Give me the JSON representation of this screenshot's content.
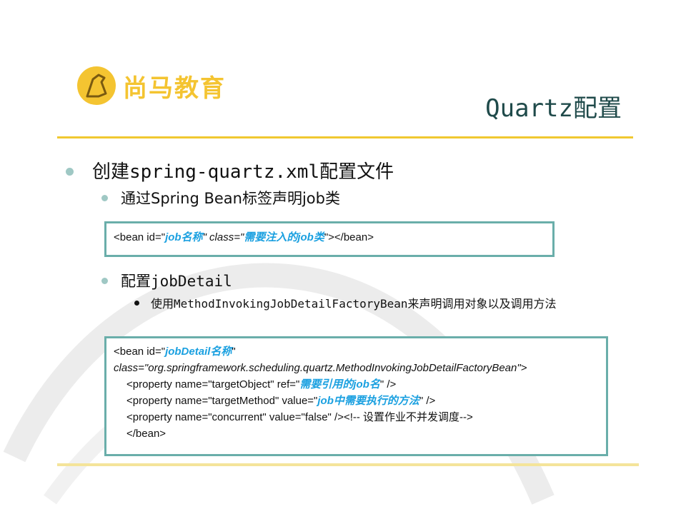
{
  "slide": {
    "logo_text": "尚马教育",
    "title": "Quartz配置"
  },
  "bullets": {
    "b1": "创建spring-quartz.xml配置文件",
    "b1_1": "通过Spring Bean标签声明job类",
    "b1_2": "配置jobDetail",
    "b1_2_1": "使用MethodInvokingJobDetailFactoryBean来声明调用对象以及调用方法"
  },
  "code1": {
    "p1": "<bean id=\"",
    "id_val": "job名称",
    "p2": "\" class=\"",
    "class_val": "需要注入的job类",
    "p3": "\"></bean>"
  },
  "code2": {
    "l1_p1": "<bean id=\"",
    "l1_id": "jobDetail名称",
    "l1_p2": "\"",
    "l2": "class=\"org.springframework.scheduling.quartz.MethodInvokingJobDetailFactoryBean\">",
    "l3_p1": "<property name=\"targetObject\" ref=\"",
    "l3_val": "需要引用的job名",
    "l3_p2": "\" />",
    "l4_p1": "<property name=\"targetMethod\" value=\"",
    "l4_val": "job中需要执行的方法",
    "l4_p2": "\" />",
    "l5": "<property name=\"concurrent\" value=\"false\" /><!-- 设置作业不并发调度-->",
    "l6": "</bean>"
  },
  "colors": {
    "accent_yellow": "#f0c830",
    "bullet_teal": "#9fc8c4",
    "box_border": "#6aaeaa",
    "highlight_blue": "#1aa0e0",
    "title_color": "#1f4a4a"
  }
}
